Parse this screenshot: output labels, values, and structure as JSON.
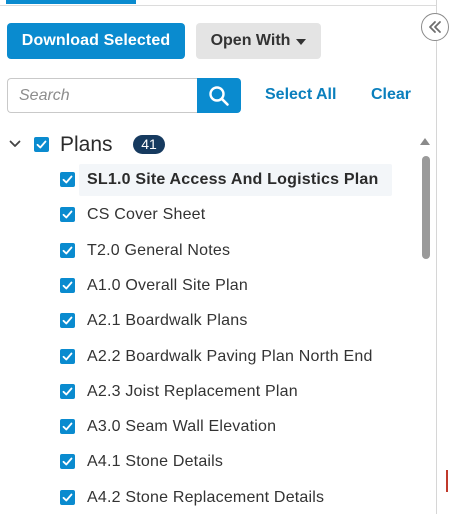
{
  "toolbar": {
    "download_label": "Download Selected",
    "open_with_label": "Open With"
  },
  "search": {
    "placeholder": "Search",
    "value": ""
  },
  "actions": {
    "select_all": "Select All",
    "clear": "Clear"
  },
  "group": {
    "title": "Plans",
    "count": "41",
    "expanded": true,
    "checked": true
  },
  "items": [
    {
      "label": "SL1.0 Site Access And Logistics Plan",
      "checked": true,
      "selected": true
    },
    {
      "label": "CS Cover Sheet",
      "checked": true
    },
    {
      "label": "T2.0 General Notes",
      "checked": true
    },
    {
      "label": "A1.0 Overall Site Plan",
      "checked": true
    },
    {
      "label": "A2.1 Boardwalk Plans",
      "checked": true
    },
    {
      "label": "A2.2 Boardwalk Paving Plan North End",
      "checked": true
    },
    {
      "label": "A2.3 Joist Replacement Plan",
      "checked": true
    },
    {
      "label": "A3.0 Seam Wall Elevation",
      "checked": true
    },
    {
      "label": "A4.1 Stone Details",
      "checked": true
    },
    {
      "label": "A4.2 Stone Replacement Details",
      "checked": true
    }
  ],
  "colors": {
    "accent": "#0a8bcf",
    "badge": "#163a5f",
    "secondary_button": "#e4e4e4"
  },
  "icons": {
    "search": "search-icon",
    "collapse": "double-chevron-left-icon",
    "group_toggle": "chevron-down-icon",
    "checkbox": "check-icon",
    "dropdown": "caret-down-icon"
  }
}
